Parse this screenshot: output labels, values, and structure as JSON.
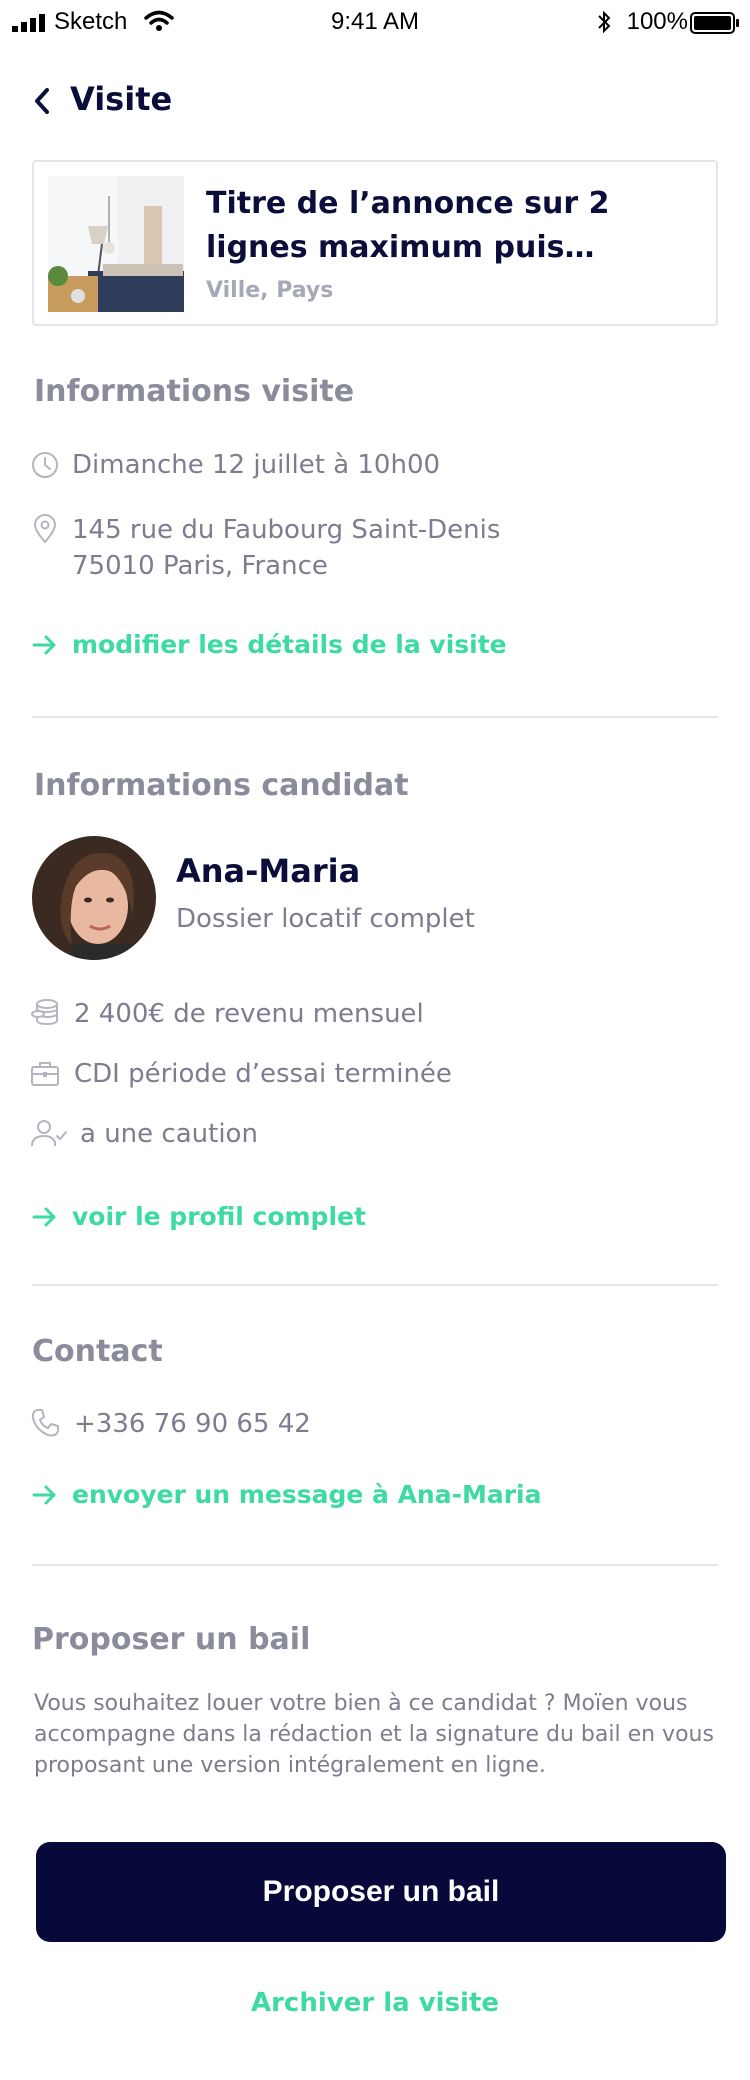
{
  "status_bar": {
    "carrier": "Sketch",
    "time": "9:41 AM",
    "battery": "100%"
  },
  "nav": {
    "title": "Visite"
  },
  "listing": {
    "title": "Titre de l’annonce sur 2 lignes maximum puis…",
    "location": "Ville, Pays"
  },
  "visit": {
    "section_title": "Informations visite",
    "date": "Dimanche 12 juillet à 10h00",
    "address_line1": "145 rue du Faubourg Saint-Denis",
    "address_line2": "75010 Paris, France",
    "edit_link": "modifier les détails de la visite"
  },
  "candidate": {
    "section_title": "Informations candidat",
    "name": "Ana-Maria",
    "status": "Dossier locatif complet",
    "income": "2 400€ de revenu mensuel",
    "contract": "CDI  période d’essai terminée",
    "guarantor": "a une caution",
    "profile_link": "voir le profil complet"
  },
  "contact": {
    "section_title": "Contact",
    "phone": "+336 76 90 65 42",
    "message_link": "envoyer un message à Ana-Maria"
  },
  "lease": {
    "section_title": "Proposer un bail",
    "description": "Vous souhaitez louer votre bien à ce candidat ? Moïen vous accompagne dans la rédaction et la signature du bail en vous proposant une version intégralement en ligne.",
    "button_label": "Proposer un bail",
    "archive_label": "Archiver la visite"
  },
  "colors": {
    "navy": "#07093a",
    "accent": "#3ddaa1",
    "muted": "#7c7e8f",
    "heading": "#8a8c9c"
  },
  "icons": [
    "signal-icon",
    "wifi-icon",
    "bluetooth-icon",
    "battery-icon",
    "back-chevron-icon",
    "clock-icon",
    "location-pin-icon",
    "arrow-right-icon",
    "coins-icon",
    "briefcase-icon",
    "user-check-icon",
    "phone-icon"
  ]
}
